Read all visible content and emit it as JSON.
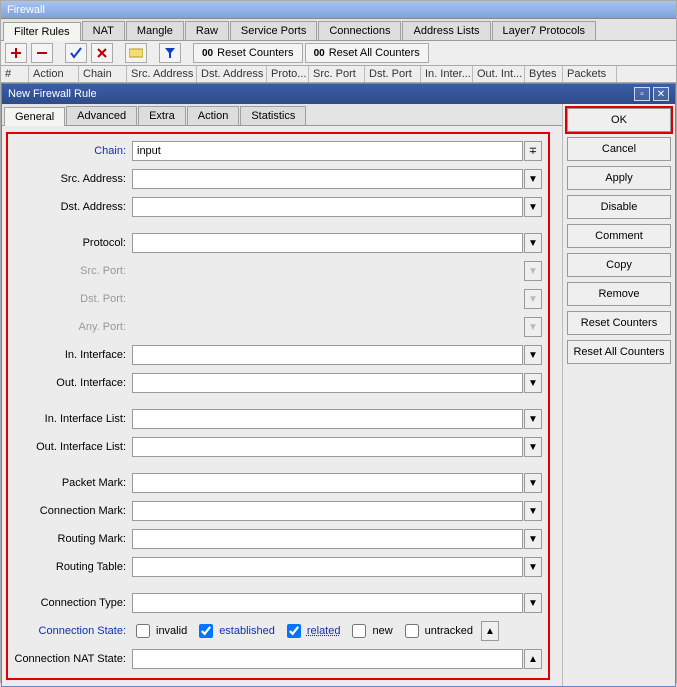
{
  "window": {
    "title": "Firewall"
  },
  "main_tabs": {
    "items": [
      {
        "label": "Filter Rules",
        "active": true
      },
      {
        "label": "NAT"
      },
      {
        "label": "Mangle"
      },
      {
        "label": "Raw"
      },
      {
        "label": "Service Ports"
      },
      {
        "label": "Connections"
      },
      {
        "label": "Address Lists"
      },
      {
        "label": "Layer7 Protocols"
      }
    ]
  },
  "toolbar": {
    "reset_counters": "Reset Counters",
    "reset_all_counters": "Reset All Counters"
  },
  "grid_columns": [
    "#",
    "Action",
    "Chain",
    "Src. Address",
    "Dst. Address",
    "Proto...",
    "Src. Port",
    "Dst. Port",
    "In. Inter...",
    "Out. Int...",
    "Bytes",
    "Packets"
  ],
  "grid_widths": [
    28,
    50,
    48,
    70,
    70,
    42,
    56,
    56,
    52,
    52,
    38,
    54
  ],
  "dialog": {
    "title": "New Firewall Rule",
    "tabs": [
      {
        "label": "General",
        "active": true
      },
      {
        "label": "Advanced"
      },
      {
        "label": "Extra"
      },
      {
        "label": "Action"
      },
      {
        "label": "Statistics"
      }
    ],
    "fields": {
      "chain": {
        "label": "Chain:",
        "value": "input",
        "blue": true,
        "kind": "combo-req"
      },
      "src_addr": {
        "label": "Src. Address:",
        "value": "",
        "kind": "combo"
      },
      "dst_addr": {
        "label": "Dst. Address:",
        "value": "",
        "kind": "combo"
      },
      "protocol": {
        "label": "Protocol:",
        "value": "",
        "kind": "combo",
        "gap": true
      },
      "src_port": {
        "label": "Src. Port:",
        "value": "",
        "kind": "disabled"
      },
      "dst_port": {
        "label": "Dst. Port:",
        "value": "",
        "kind": "disabled"
      },
      "any_port": {
        "label": "Any. Port:",
        "value": "",
        "kind": "disabled"
      },
      "in_if": {
        "label": "In. Interface:",
        "value": "",
        "kind": "combo"
      },
      "out_if": {
        "label": "Out. Interface:",
        "value": "",
        "kind": "combo"
      },
      "in_if_list": {
        "label": "In. Interface List:",
        "value": "",
        "kind": "combo",
        "gap": true
      },
      "out_if_list": {
        "label": "Out. Interface List:",
        "value": "",
        "kind": "combo"
      },
      "packet_mark": {
        "label": "Packet Mark:",
        "value": "",
        "kind": "combo",
        "gap": true
      },
      "conn_mark": {
        "label": "Connection Mark:",
        "value": "",
        "kind": "combo"
      },
      "routing_mark": {
        "label": "Routing Mark:",
        "value": "",
        "kind": "combo"
      },
      "routing_table": {
        "label": "Routing Table:",
        "value": "",
        "kind": "combo"
      },
      "conn_type": {
        "label": "Connection Type:",
        "value": "",
        "kind": "combo",
        "gap": true
      },
      "conn_nat_state": {
        "label": "Connection NAT State:",
        "value": "",
        "kind": "combo-up"
      }
    },
    "conn_state": {
      "label": "Connection State:",
      "invalid": {
        "label": "invalid",
        "checked": false
      },
      "established": {
        "label": "established",
        "checked": true
      },
      "related": {
        "label": "related",
        "checked": true
      },
      "new": {
        "label": "new",
        "checked": false
      },
      "untracked": {
        "label": "untracked",
        "checked": false
      }
    },
    "buttons": {
      "ok": "OK",
      "cancel": "Cancel",
      "apply": "Apply",
      "disable": "Disable",
      "comment": "Comment",
      "copy": "Copy",
      "remove": "Remove",
      "reset_counters": "Reset Counters",
      "reset_all_counters": "Reset All Counters"
    }
  }
}
